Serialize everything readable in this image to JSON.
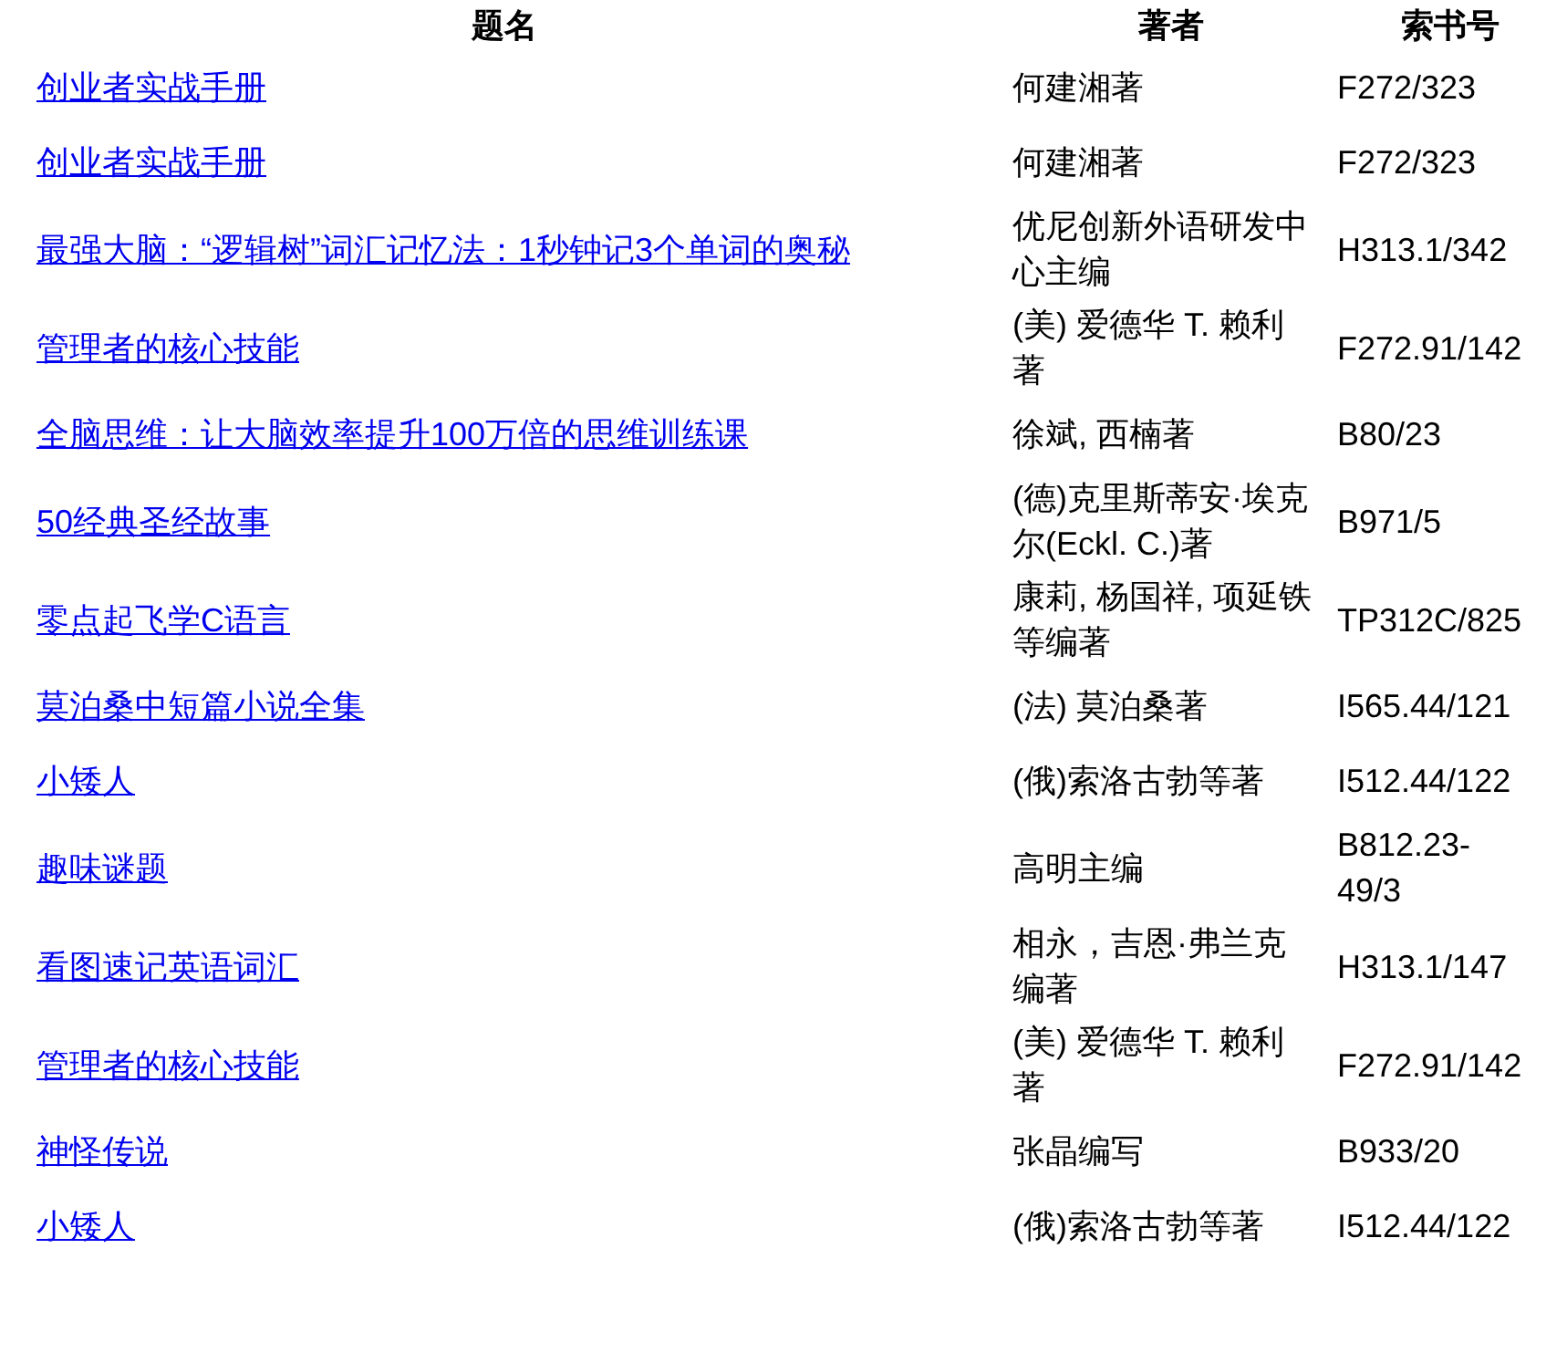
{
  "table": {
    "columns": [
      "题名",
      "著者",
      "索书号"
    ],
    "rows": [
      {
        "title": "创业者实战手册",
        "author": "何建湘著",
        "call_number": "F272/323"
      },
      {
        "title": "创业者实战手册",
        "author": "何建湘著",
        "call_number": "F272/323"
      },
      {
        "title": "最强大脑：“逻辑树”词汇记忆法：1秒钟记3个单词的奥秘",
        "author": "优尼创新外语研发中心主编",
        "call_number": "H313.1/342"
      },
      {
        "title": "管理者的核心技能",
        "author": "(美) 爱德华 T. 赖利著",
        "call_number": "F272.91/142"
      },
      {
        "title": "全脑思维：让大脑效率提升100万倍的思维训练课",
        "author": "徐斌, 西楠著",
        "call_number": "B80/23"
      },
      {
        "title": "50经典圣经故事",
        "author": "(德)克里斯蒂安·埃克尔(Eckl. C.)著",
        "call_number": "B971/5"
      },
      {
        "title": "零点起飞学C语言",
        "author": "康莉, 杨国祥, 项延铁等编著",
        "call_number": "TP312C/825"
      },
      {
        "title": "莫泊桑中短篇小说全集",
        "author": "(法) 莫泊桑著",
        "call_number": "I565.44/121"
      },
      {
        "title": "小矮人",
        "author": "(俄)索洛古勃等著",
        "call_number": "I512.44/122"
      },
      {
        "title": "趣味谜题",
        "author": "高明主编",
        "call_number": "B812.23-49/3"
      },
      {
        "title": "看图速记英语词汇",
        "author": "相永，吉恩·弗兰克编著",
        "call_number": "H313.1/147"
      },
      {
        "title": "管理者的核心技能",
        "author": "(美) 爱德华 T. 赖利著",
        "call_number": "F272.91/142"
      },
      {
        "title": "神怪传说",
        "author": "张晶编写",
        "call_number": "B933/20"
      },
      {
        "title": "小矮人",
        "author": "(俄)索洛古勃等著",
        "call_number": "I512.44/122"
      }
    ]
  }
}
